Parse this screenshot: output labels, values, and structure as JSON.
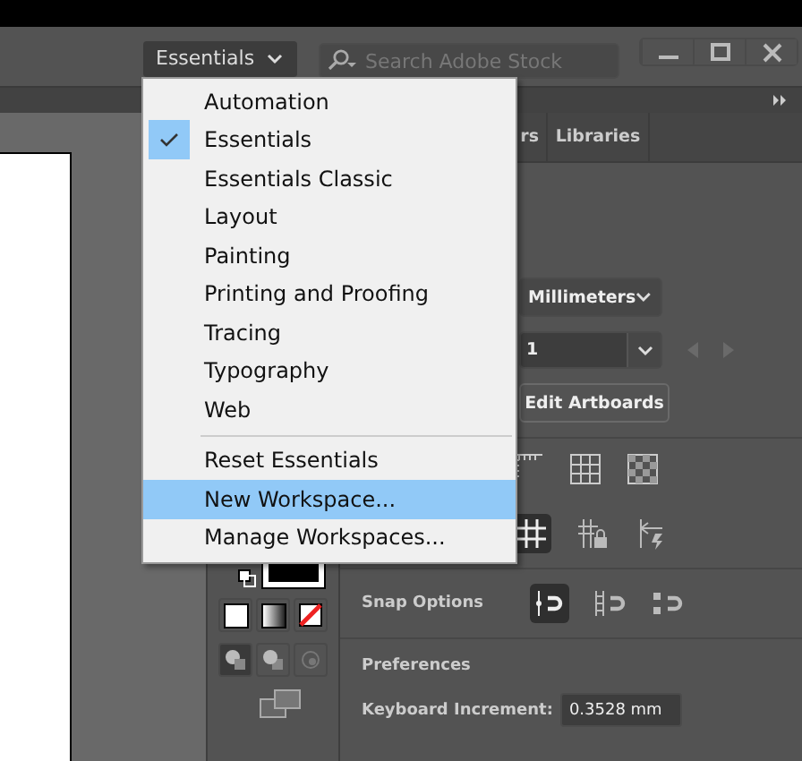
{
  "workspace_switcher": {
    "label": "Essentials"
  },
  "search": {
    "placeholder": "Search Adobe Stock"
  },
  "panel_tabs": [
    {
      "label": "rs"
    },
    {
      "label": "Libraries"
    }
  ],
  "properties": {
    "units": "Millimeters",
    "artboard": "1",
    "edit_button": "Edit Artboards",
    "snap_label": "Snap Options",
    "preferences_heading": "Preferences",
    "keyboard_increment_label": "Keyboard Increment:",
    "keyboard_increment_value": "0.3528 mm"
  },
  "menu": {
    "workspaces": [
      {
        "label": "Automation",
        "checked": false
      },
      {
        "label": "Essentials",
        "checked": true
      },
      {
        "label": "Essentials Classic",
        "checked": false
      },
      {
        "label": "Layout",
        "checked": false
      },
      {
        "label": "Painting",
        "checked": false
      },
      {
        "label": "Printing and Proofing",
        "checked": false
      },
      {
        "label": "Tracing",
        "checked": false
      },
      {
        "label": "Typography",
        "checked": false
      },
      {
        "label": "Web",
        "checked": false
      }
    ],
    "commands": [
      {
        "label": "Reset Essentials",
        "selected": false
      },
      {
        "label": "New Workspace...",
        "selected": true
      },
      {
        "label": "Manage Workspaces...",
        "selected": false
      }
    ]
  }
}
